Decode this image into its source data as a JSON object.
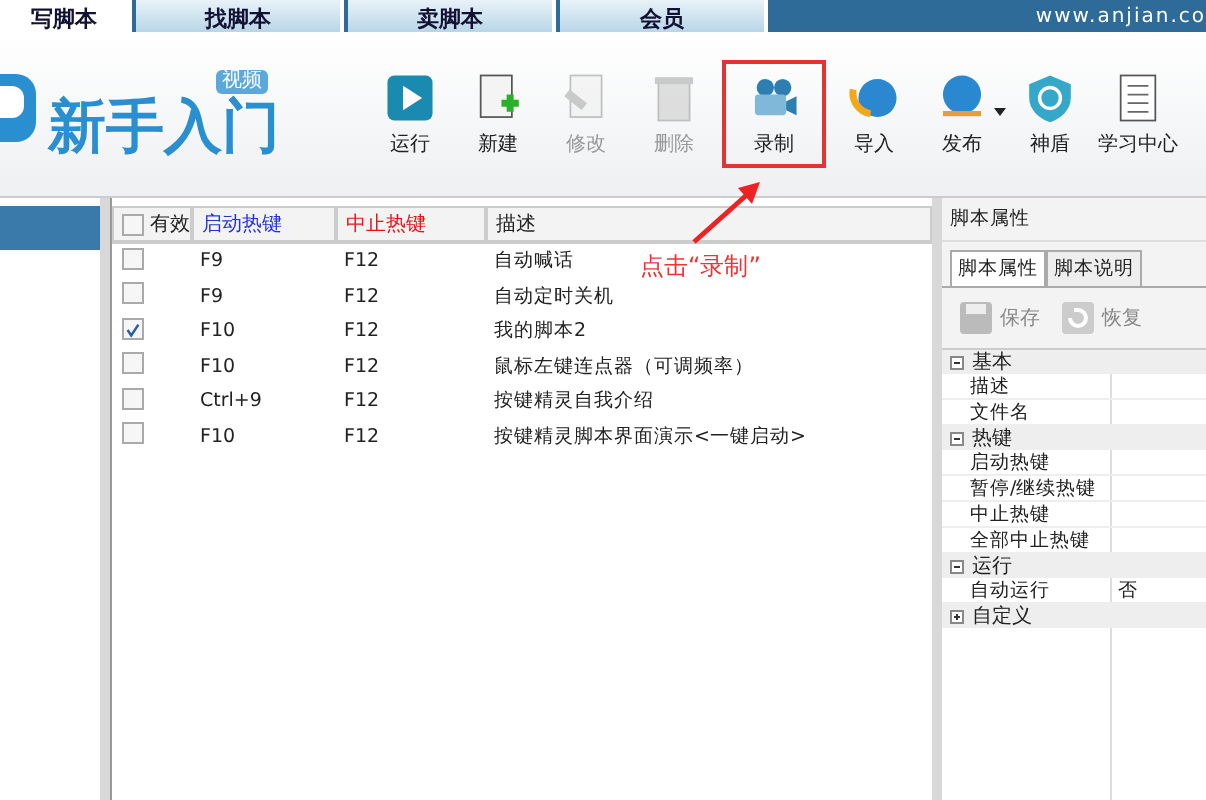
{
  "top_tabs": [
    {
      "label": "写脚本",
      "selected": true
    },
    {
      "label": "找脚本",
      "selected": false
    },
    {
      "label": "卖脚本",
      "selected": false
    },
    {
      "label": "会员",
      "selected": false
    }
  ],
  "site_url": "www.anjian.co",
  "logo": {
    "title": "新手入门",
    "badge": "视频"
  },
  "toolbar": [
    {
      "label": "运行",
      "kind": "play",
      "disabled": false,
      "highlighted": false,
      "has_menu": false
    },
    {
      "label": "新建",
      "kind": "new",
      "disabled": false,
      "highlighted": false,
      "has_menu": false
    },
    {
      "label": "修改",
      "kind": "edit",
      "disabled": true,
      "highlighted": false,
      "has_menu": false
    },
    {
      "label": "删除",
      "kind": "delete",
      "disabled": true,
      "highlighted": false,
      "has_menu": false
    },
    {
      "label": "录制",
      "kind": "record",
      "disabled": false,
      "highlighted": true,
      "has_menu": false
    },
    {
      "label": "导入",
      "kind": "import",
      "disabled": false,
      "highlighted": false,
      "has_menu": false
    },
    {
      "label": "发布",
      "kind": "publish",
      "disabled": false,
      "highlighted": false,
      "has_menu": true
    },
    {
      "label": "神盾",
      "kind": "shield",
      "disabled": false,
      "highlighted": false,
      "has_menu": false
    },
    {
      "label": "学习中心",
      "kind": "book",
      "disabled": false,
      "highlighted": false,
      "has_menu": false
    }
  ],
  "annotation": "点击“录制”",
  "table": {
    "select_all_checked": false,
    "columns": [
      {
        "label": "有效",
        "kind": "check"
      },
      {
        "label": "启动热键",
        "kind": "start"
      },
      {
        "label": "中止热键",
        "kind": "stop"
      },
      {
        "label": "描述",
        "kind": "text"
      }
    ],
    "rows": [
      {
        "checked": false,
        "start": "F9",
        "stop": "F12",
        "desc": "自动喊话"
      },
      {
        "checked": false,
        "start": "F9",
        "stop": "F12",
        "desc": "自动定时关机"
      },
      {
        "checked": true,
        "start": "F10",
        "stop": "F12",
        "desc": "我的脚本2"
      },
      {
        "checked": false,
        "start": "F10",
        "stop": "F12",
        "desc": "鼠标左键连点器（可调频率）"
      },
      {
        "checked": false,
        "start": "Ctrl+9",
        "stop": "F12",
        "desc": "按键精灵自我介绍"
      },
      {
        "checked": false,
        "start": "F10",
        "stop": "F12",
        "desc": "按键精灵脚本界面演示<一键启动>"
      }
    ]
  },
  "properties": {
    "title": "脚本属性",
    "tabs": [
      {
        "label": "脚本属性",
        "selected": true
      },
      {
        "label": "脚本说明",
        "selected": false
      }
    ],
    "actions": [
      {
        "label": "保存",
        "kind": "save"
      },
      {
        "label": "恢复",
        "kind": "restore"
      }
    ],
    "groups": [
      {
        "name": "基本",
        "expanded": true,
        "children": [
          {
            "name": "描述"
          },
          {
            "name": "文件名"
          }
        ]
      },
      {
        "name": "热键",
        "expanded": true,
        "children": [
          {
            "name": "启动热键"
          },
          {
            "name": "暂停/继续热键"
          },
          {
            "name": "中止热键"
          },
          {
            "name": "全部中止热键"
          }
        ]
      },
      {
        "name": "运行",
        "expanded": true,
        "children": [
          {
            "name": "自动运行",
            "value": "否"
          }
        ]
      },
      {
        "name": "自定义",
        "expanded": false
      }
    ]
  }
}
